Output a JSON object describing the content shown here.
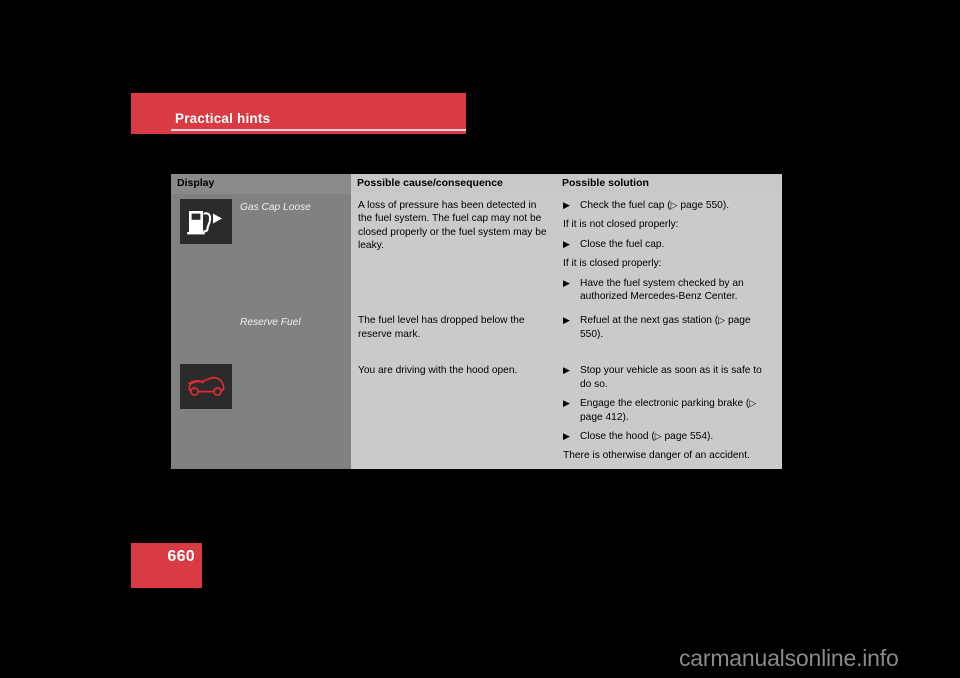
{
  "chapter": {
    "title": "Practical hints"
  },
  "page": {
    "number": "660"
  },
  "watermark": {
    "text": "carmanualsonline.info"
  },
  "table": {
    "headers": {
      "display": "Display",
      "cause": "Possible cause/consequence",
      "solution": "Possible solution"
    },
    "rows": [
      {
        "icon": "gas-pump-icon",
        "display_label": "Gas Cap Loose",
        "cause": "A loss of pressure has been detected in the fuel system. The fuel cap may not be closed properly or the fuel system may be leaky.",
        "solution": [
          {
            "kind": "bullet",
            "text": "Check the fuel cap (",
            "ref_mark": "▷",
            "ref_text": " page 550).",
            "text_after": ""
          },
          {
            "kind": "para",
            "text": "If it is not closed properly:"
          },
          {
            "kind": "bullet",
            "text": "Close the fuel cap."
          },
          {
            "kind": "para",
            "text": "If it is closed properly:"
          },
          {
            "kind": "bullet",
            "text": "Have the fuel system checked by an authorized Mercedes-Benz Center."
          }
        ]
      },
      {
        "icon": "none",
        "display_label": "Reserve Fuel",
        "cause": "The fuel level has dropped below the reserve mark.",
        "solution": [
          {
            "kind": "bullet",
            "text": "Refuel at the next gas station (",
            "ref_mark": "▷",
            "ref_text": " page 550)."
          }
        ]
      },
      {
        "icon": "car-hood-open-icon",
        "display_label": "",
        "cause": "You are driving with the hood open.",
        "solution": [
          {
            "kind": "bullet",
            "text": "Stop your vehicle as soon as it is safe to do so."
          },
          {
            "kind": "bullet",
            "text": "Engage the electronic parking brake (",
            "ref_mark": "▷",
            "ref_text": " page 412)."
          },
          {
            "kind": "bullet",
            "text": "Close the hood (",
            "ref_mark": "▷",
            "ref_text": " page 554)."
          },
          {
            "kind": "para",
            "text": "There is otherwise danger of an accident."
          }
        ]
      }
    ],
    "bullet_glyph": "▶"
  },
  "colors": {
    "brand_red": "#d93b45",
    "display_column_bg": "#818181",
    "cell_bg": "#cacaca",
    "icon_box_bg": "#2b2b2b",
    "warning_icon_red": "#e02b35",
    "page_bg": "#000000"
  }
}
